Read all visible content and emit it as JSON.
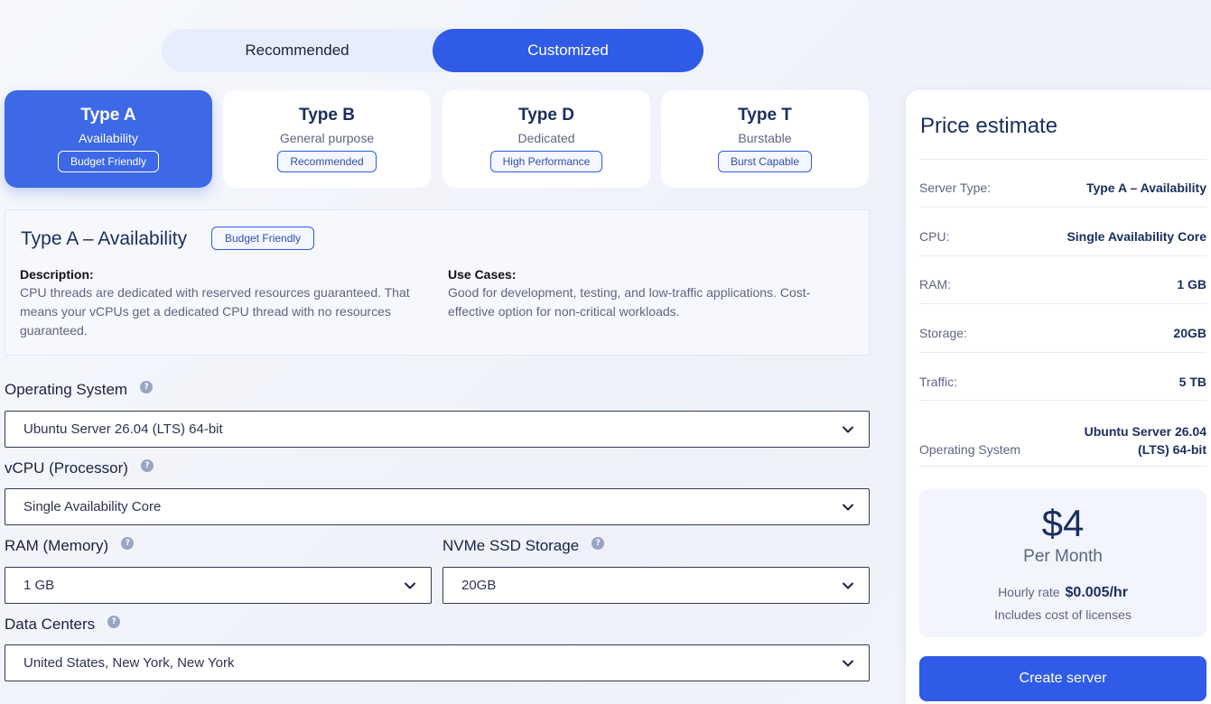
{
  "mode_toggle": {
    "recommended": "Recommended",
    "customized": "Customized",
    "active": "customized"
  },
  "type_cards": [
    {
      "title": "Type A",
      "subtitle": "Availability",
      "badge": "Budget Friendly",
      "active": true
    },
    {
      "title": "Type B",
      "subtitle": "General purpose",
      "badge": "Recommended",
      "active": false
    },
    {
      "title": "Type D",
      "subtitle": "Dedicated",
      "badge": "High Performance",
      "active": false
    },
    {
      "title": "Type T",
      "subtitle": "Burstable",
      "badge": "Burst Capable",
      "active": false
    }
  ],
  "details": {
    "title": "Type A – Availability",
    "badge": "Budget Friendly",
    "description_heading": "Description:",
    "description": "CPU threads are dedicated with reserved resources guaranteed. That means your vCPUs get a dedicated CPU thread with no resources guaranteed.",
    "use_cases_heading": "Use Cases:",
    "use_cases": "Good for development, testing, and low-traffic applications. Cost-effective option for non-critical workloads."
  },
  "form": {
    "help_glyph": "?",
    "os": {
      "label": "Operating System",
      "value": "Ubuntu Server 26.04 (LTS) 64-bit"
    },
    "vcpu": {
      "label": "vCPU (Processor)",
      "value": "Single Availability Core"
    },
    "ram": {
      "label": "RAM (Memory)",
      "value": "1 GB"
    },
    "storage": {
      "label": "NVMe SSD Storage",
      "value": "20GB"
    },
    "datacenter": {
      "label": "Data Centers",
      "value": "United States, New York, New York"
    }
  },
  "price": {
    "title": "Price estimate",
    "rows": [
      {
        "key": "Server Type:",
        "value": "Type A – Availability"
      },
      {
        "key": "CPU:",
        "value": "Single Availability Core"
      },
      {
        "key": "RAM:",
        "value": "1 GB"
      },
      {
        "key": "Storage:",
        "value": "20GB"
      },
      {
        "key": "Traffic:",
        "value": "5 TB"
      }
    ],
    "os_key": "Operating System",
    "os_value_line1": "Ubuntu Server 26.04",
    "os_value_line2": "(LTS) 64-bit",
    "amount": "$4",
    "period": "Per Month",
    "hourly_label": "Hourly rate",
    "hourly_value": "$0.005/hr",
    "license_note": "Includes cost of licenses",
    "create_button": "Create server"
  },
  "colors": {
    "accent": "#2f5be7",
    "active_card": "#3d68e6",
    "heading": "#1a2d5e"
  }
}
